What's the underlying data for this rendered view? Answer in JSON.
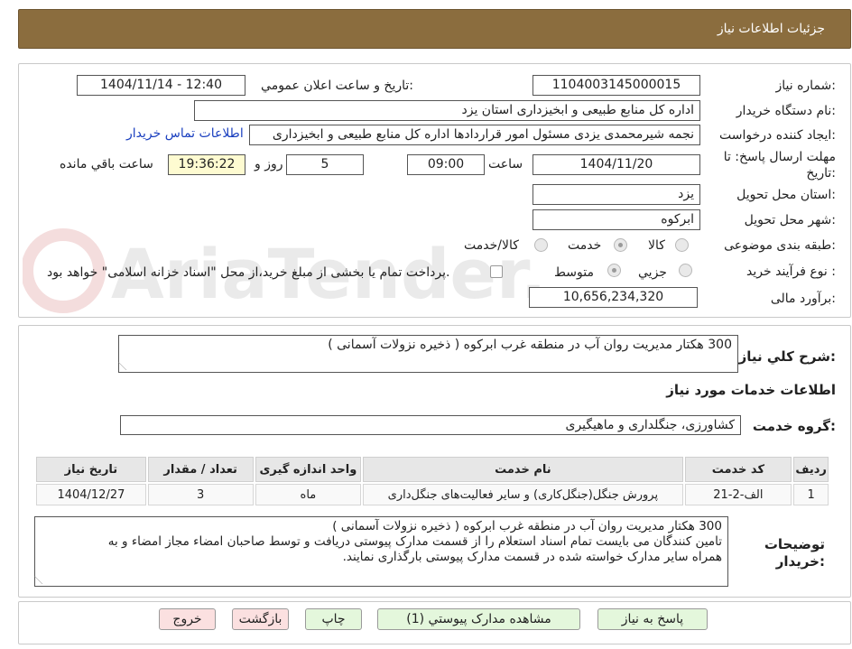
{
  "header": {
    "title": "جزئیات اطلاعات نیاز"
  },
  "labels": {
    "need_number": "شماره نیاز:",
    "announce_datetime": "تاریخ و ساعت اعلان عمومي:",
    "buyer_org": "نام دستگاه خريدار:",
    "requester": "ایجاد کننده درخواست:",
    "deadline": "مهلت ارسال پاسخ: تا تاریخ:",
    "time_word": "ساعت",
    "day_and": "روز و",
    "remaining": "ساعت باقي مانده",
    "province": "استان محل تحویل:",
    "city": "شهر محل تحویل:",
    "category": "طبقه بندی موضوعی:",
    "process": "نوع فرآیند خرید :",
    "budget": "برآورد مالی:",
    "description": "شرح کلي نیاز:",
    "services_heading": "اطلاعات خدمات مورد نیاز",
    "service_group": "گروه خدمت:",
    "buyer_notes": "توضیحات خریدار:"
  },
  "fields": {
    "need_number": "1104003145000015",
    "announce_datetime": "1404/11/14 - 12:40",
    "buyer_org": "اداره کل منابع طبیعی و ابخیزداری استان یزد",
    "requester": "نجمه شیرمحمدی یزدی مسئول امور قراردادها اداره کل منابع طبیعی و ابخیزداری",
    "contact_link": "اطلاعات تماس خریدار",
    "deadline_date": "1404/11/20",
    "deadline_time": "09:00",
    "days": "5",
    "remaining_time": "19:36:22",
    "province": "یزد",
    "city": "ابرکوه",
    "budget": "10,656,234,320",
    "description": "300 هکتار مدیریت روان آب در منطقه غرب ابرکوه ( ذخیره نزولات آسمانی )",
    "service_group": "کشاورزی، جنگلداری و ماهیگیری"
  },
  "category_options": [
    {
      "label": "کالا",
      "selected": false
    },
    {
      "label": "خدمت",
      "selected": true
    },
    {
      "label": "کالا/خدمت",
      "selected": false
    }
  ],
  "process_options": [
    {
      "label": "جزیي",
      "selected": false
    },
    {
      "label": "متوسط",
      "selected": true
    }
  ],
  "treasury_note": "پرداخت تمام یا بخشی از مبلغ خرید،از محل \"اسناد خزانه اسلامی\" خواهد بود.",
  "table": {
    "headers": [
      "ردیف",
      "کد خدمت",
      "نام خدمت",
      "واحد اندازه گیری",
      "تعداد / مقدار",
      "تاریخ نیاز"
    ],
    "rows": [
      [
        "1",
        "الف-2-21",
        "پرورش جنگل(جنگل‌کاری) و سایر فعالیت‌های جنگل‌داری",
        "ماه",
        "3",
        "1404/12/27"
      ]
    ]
  },
  "notes_lines": [
    "300 هکتار مدیریت روان آب در منطقه غرب ابرکوه ( ذخیره نزولات آسمانی )",
    "تامین کنندگان می بایست تمام اسناد استعلام را از قسمت مدارک پیوستی دریافت و توسط صاحبان امضاء مجاز امضاء و به",
    "همراه سایر مدارک خواسته شده در قسمت مدارک پیوستی بارگذاری نمایند."
  ],
  "buttons": {
    "reply": "پاسخ به نیاز",
    "attachments": "مشاهده مدارک پیوستي (1)",
    "print": "چاپ",
    "back": "بازگشت",
    "exit": "خروج"
  },
  "watermark": {
    "text": "AriaTender.net"
  },
  "colors": {
    "header": "#8b6d3e",
    "green_button": "#e4f7dc",
    "pink_button": "#fbe0e0",
    "highlight": "#fefbd1"
  }
}
